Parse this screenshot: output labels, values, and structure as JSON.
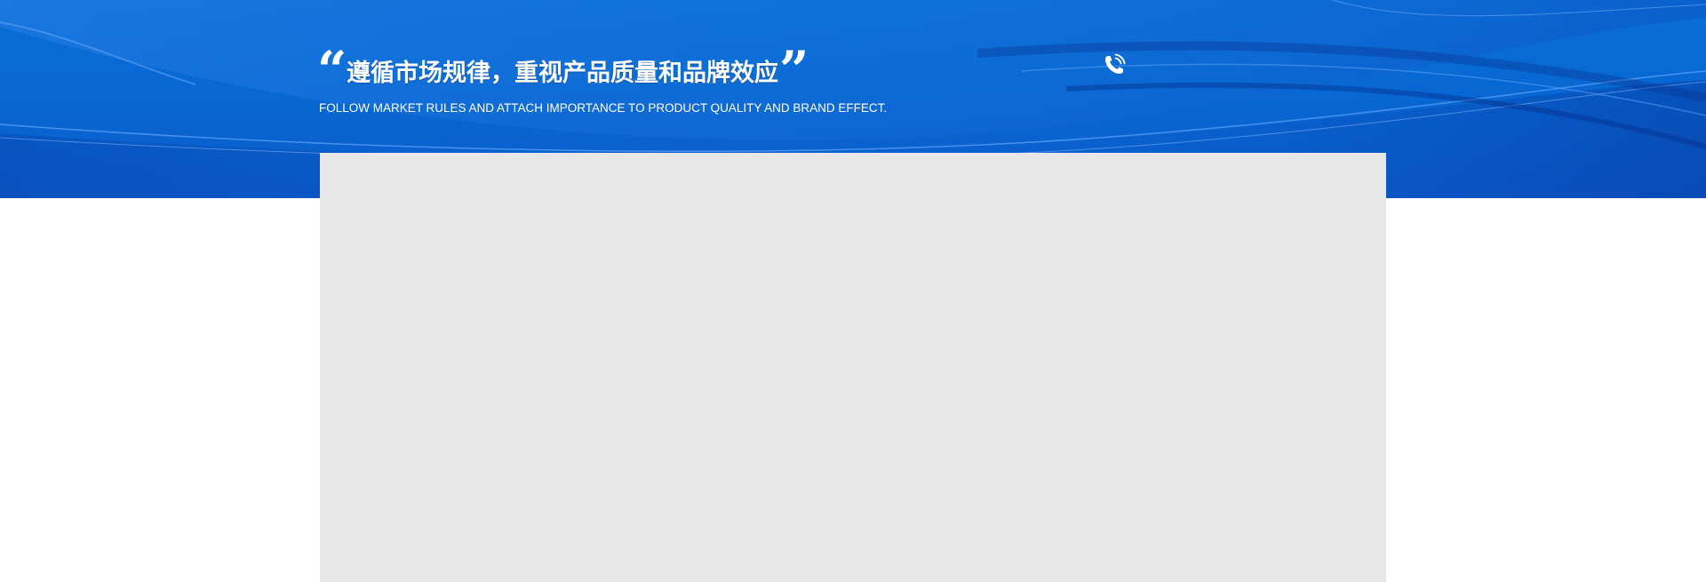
{
  "banner": {
    "slogan_cn": "遵循市场规律，重视产品质量和品牌效应",
    "quote_open": "“",
    "quote_close": "”",
    "slogan_en": "FOLLOW MARKET RULES AND ATTACH IMPORTANCE TO PRODUCT QUALITY AND BRAND EFFECT.",
    "phone_icon": "phone-icon"
  },
  "colors": {
    "banner_blue": "#0868d3",
    "content_gray": "#e7e7e7"
  }
}
